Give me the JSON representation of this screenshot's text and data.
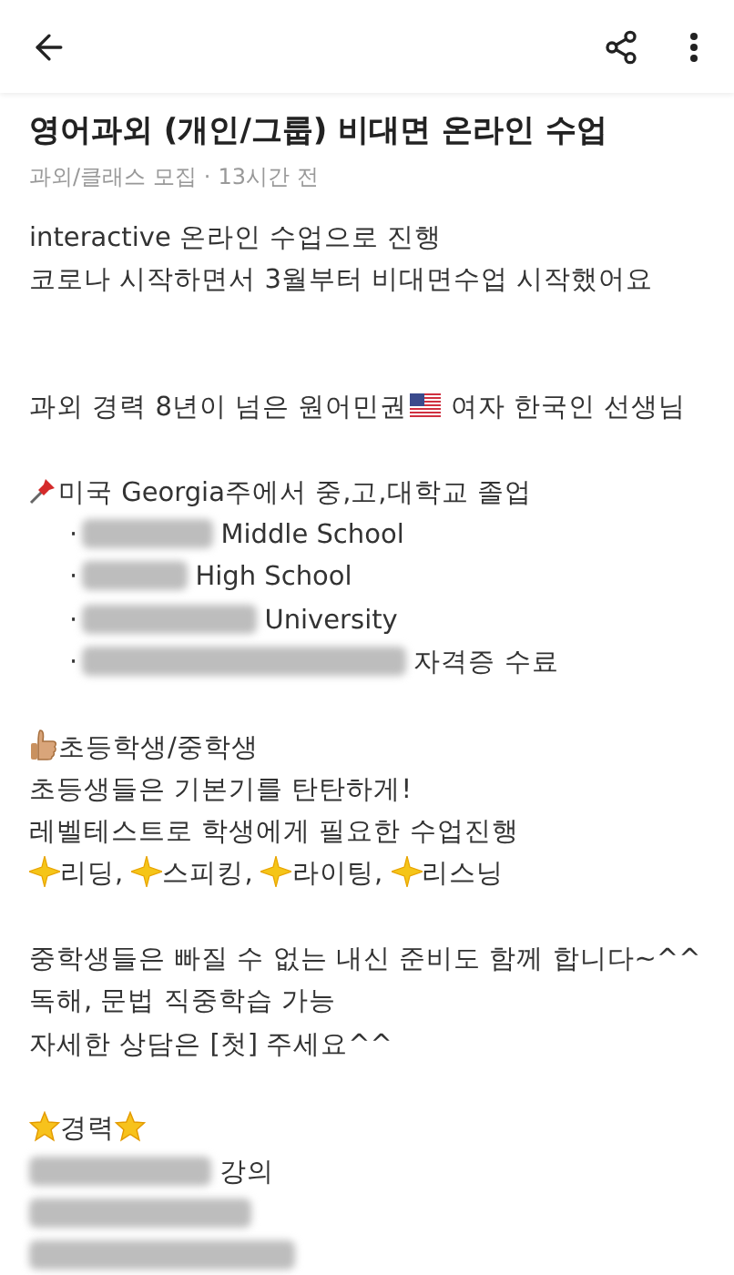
{
  "post": {
    "title": "영어과외 (개인/그룹) 비대면 온라인 수업",
    "category": "과외/클래스 모집",
    "separator": "·",
    "time": "13시간 전"
  },
  "body": [
    {
      "kind": "line",
      "parts": [
        {
          "kind": "text",
          "text": "interactive 온라인 수업으로 진행"
        }
      ]
    },
    {
      "kind": "line",
      "parts": [
        {
          "kind": "text",
          "text": "코로나 시작하면서 3월부터 비대면수업 시작했어요"
        }
      ]
    },
    {
      "kind": "blank"
    },
    {
      "kind": "blank"
    },
    {
      "kind": "line",
      "parts": [
        {
          "kind": "text",
          "text": "과외 경력 8년이 넘은 원어민권"
        },
        {
          "kind": "flag"
        },
        {
          "kind": "text",
          "text": " 여자 한국인 선생님"
        }
      ]
    },
    {
      "kind": "blank"
    },
    {
      "kind": "line",
      "parts": [
        {
          "kind": "pin"
        },
        {
          "kind": "text",
          "text": "미국 Georgia주에서 중,고,대학교 졸업"
        }
      ]
    },
    {
      "kind": "bullet",
      "bullet": "·",
      "parts": [
        {
          "kind": "redacted"
        },
        {
          "kind": "text",
          "text": " Middle School"
        }
      ]
    },
    {
      "kind": "bullet",
      "bullet": "·",
      "parts": [
        {
          "kind": "redacted"
        },
        {
          "kind": "text",
          "text": " High School"
        }
      ]
    },
    {
      "kind": "bullet",
      "bullet": "·",
      "parts": [
        {
          "kind": "redacted"
        },
        {
          "kind": "text",
          "text": " University"
        }
      ]
    },
    {
      "kind": "bullet",
      "bullet": "·",
      "parts": [
        {
          "kind": "redacted"
        },
        {
          "kind": "text",
          "text": " 자격증 수료"
        }
      ]
    },
    {
      "kind": "blank"
    },
    {
      "kind": "line",
      "parts": [
        {
          "kind": "thumb"
        },
        {
          "kind": "text",
          "text": "초등학생/중학생"
        }
      ]
    },
    {
      "kind": "line",
      "parts": [
        {
          "kind": "text",
          "text": "초등생들은 기본기를 탄탄하게!"
        }
      ]
    },
    {
      "kind": "line",
      "parts": [
        {
          "kind": "text",
          "text": "레벨테스트로 학생에게 필요한 수업진행"
        }
      ]
    },
    {
      "kind": "line",
      "parts": [
        {
          "kind": "sparkle"
        },
        {
          "kind": "text",
          "text": "리딩, "
        },
        {
          "kind": "sparkle"
        },
        {
          "kind": "text",
          "text": "스피킹, "
        },
        {
          "kind": "sparkle"
        },
        {
          "kind": "text",
          "text": "라이팅, "
        },
        {
          "kind": "sparkle"
        },
        {
          "kind": "text",
          "text": "리스닝"
        }
      ]
    },
    {
      "kind": "blank"
    },
    {
      "kind": "line",
      "parts": [
        {
          "kind": "text",
          "text": "중학생들은 빠질 수 없는 내신 준비도 함께 합니다~^^"
        }
      ]
    },
    {
      "kind": "line",
      "parts": [
        {
          "kind": "text",
          "text": "독해, 문법 직중학습 가능"
        }
      ]
    },
    {
      "kind": "line",
      "parts": [
        {
          "kind": "text",
          "text": "자세한 상담은 [첫] 주세요^^"
        }
      ]
    },
    {
      "kind": "blank"
    },
    {
      "kind": "line",
      "parts": [
        {
          "kind": "star"
        },
        {
          "kind": "text",
          "text": "경력"
        },
        {
          "kind": "star"
        }
      ]
    },
    {
      "kind": "line",
      "parts": [
        {
          "kind": "redacted"
        },
        {
          "kind": "text",
          "text": " 강의"
        }
      ]
    },
    {
      "kind": "line",
      "parts": [
        {
          "kind": "redacted"
        }
      ]
    },
    {
      "kind": "line",
      "parts": [
        {
          "kind": "redacted"
        }
      ]
    }
  ]
}
